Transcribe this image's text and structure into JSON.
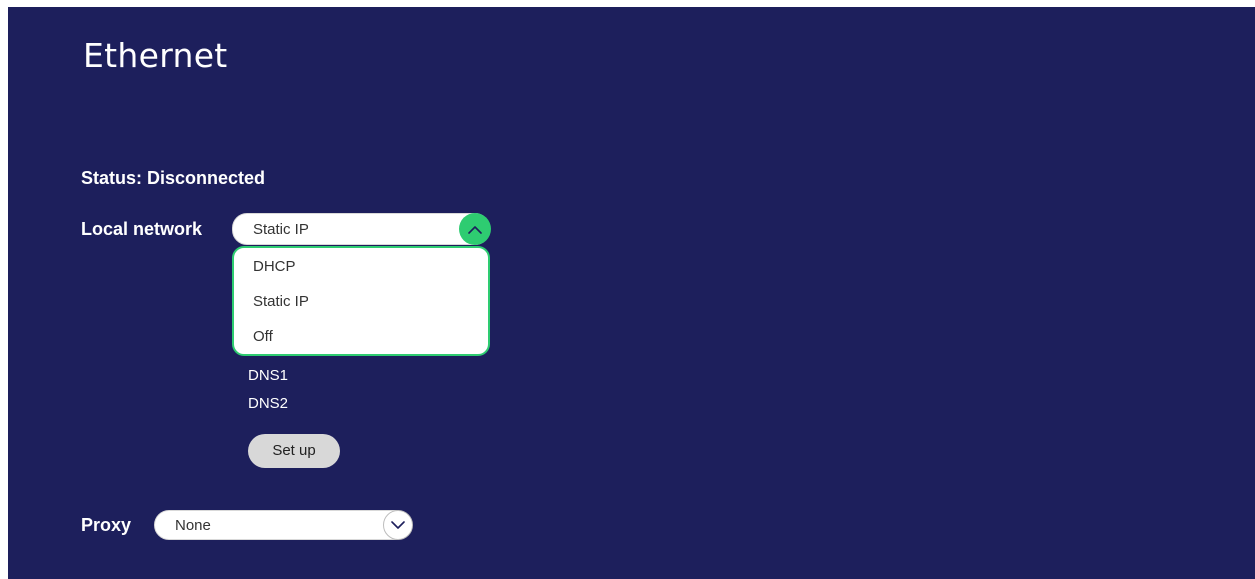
{
  "page": {
    "title": "Ethernet",
    "status_text": "Status: Disconnected"
  },
  "local_network": {
    "label": "Local network",
    "selected": "Static IP",
    "options": [
      "DHCP",
      "Static IP",
      "Off"
    ]
  },
  "details": {
    "dns1_label": "DNS1",
    "dns2_label": "DNS2"
  },
  "setup": {
    "label": "Set up"
  },
  "proxy": {
    "label": "Proxy",
    "selected": "None"
  },
  "colors": {
    "background": "#1d1f5c",
    "accent_green": "#2ecc71",
    "button_gray": "#d8d8d8"
  },
  "icons": {
    "local_toggle": "chevron-up-icon",
    "proxy_toggle": "chevron-down-icon"
  }
}
